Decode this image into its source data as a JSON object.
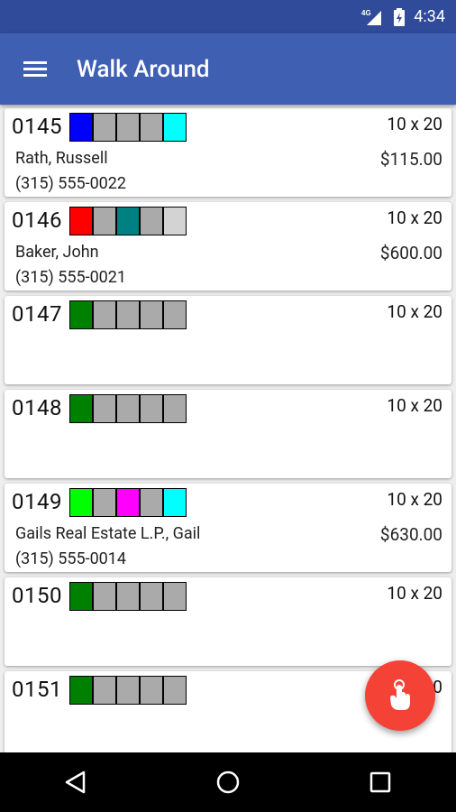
{
  "status": {
    "network": "4G",
    "time": "4:34"
  },
  "app": {
    "title": "Walk Around"
  },
  "units": [
    {
      "number": "0145",
      "size": "10 x 20",
      "tenant": "Rath, Russell",
      "price": "$115.00",
      "phone": "(315) 555-0022",
      "colors": [
        "#0000ff",
        "#aaaaaa",
        "#aaaaaa",
        "#aaaaaa",
        "#00ffff"
      ]
    },
    {
      "number": "0146",
      "size": "10 x 20",
      "tenant": "Baker, John",
      "price": "$600.00",
      "phone": "(315) 555-0021",
      "colors": [
        "#ff0000",
        "#aaaaaa",
        "#008080",
        "#aaaaaa",
        "#d3d3d3"
      ]
    },
    {
      "number": "0147",
      "size": "10 x 20",
      "tenant": "",
      "price": "",
      "phone": "",
      "colors": [
        "#008000",
        "#aaaaaa",
        "#aaaaaa",
        "#aaaaaa",
        "#aaaaaa"
      ]
    },
    {
      "number": "0148",
      "size": "10 x 20",
      "tenant": "",
      "price": "",
      "phone": "",
      "colors": [
        "#008000",
        "#aaaaaa",
        "#aaaaaa",
        "#aaaaaa",
        "#aaaaaa"
      ]
    },
    {
      "number": "0149",
      "size": "10 x 20",
      "tenant": "Gails Real Estate L.P., Gail",
      "price": "$630.00",
      "phone": "(315) 555-0014",
      "colors": [
        "#00ff00",
        "#aaaaaa",
        "#ff00ff",
        "#aaaaaa",
        "#00ffff"
      ]
    },
    {
      "number": "0150",
      "size": "10 x 20",
      "tenant": "",
      "price": "",
      "phone": "",
      "colors": [
        "#008000",
        "#aaaaaa",
        "#aaaaaa",
        "#aaaaaa",
        "#aaaaaa"
      ]
    },
    {
      "number": "0151",
      "size": "10 x 20",
      "tenant": "",
      "price": "",
      "phone": "",
      "colors": [
        "#008000",
        "#aaaaaa",
        "#aaaaaa",
        "#aaaaaa",
        "#aaaaaa"
      ]
    }
  ],
  "fab": {
    "icon": "tap-finger-icon",
    "color": "#f44336"
  },
  "nav": {
    "back_icon": "back-triangle-icon",
    "home_icon": "home-circle-icon",
    "recents_icon": "recents-square-icon"
  }
}
